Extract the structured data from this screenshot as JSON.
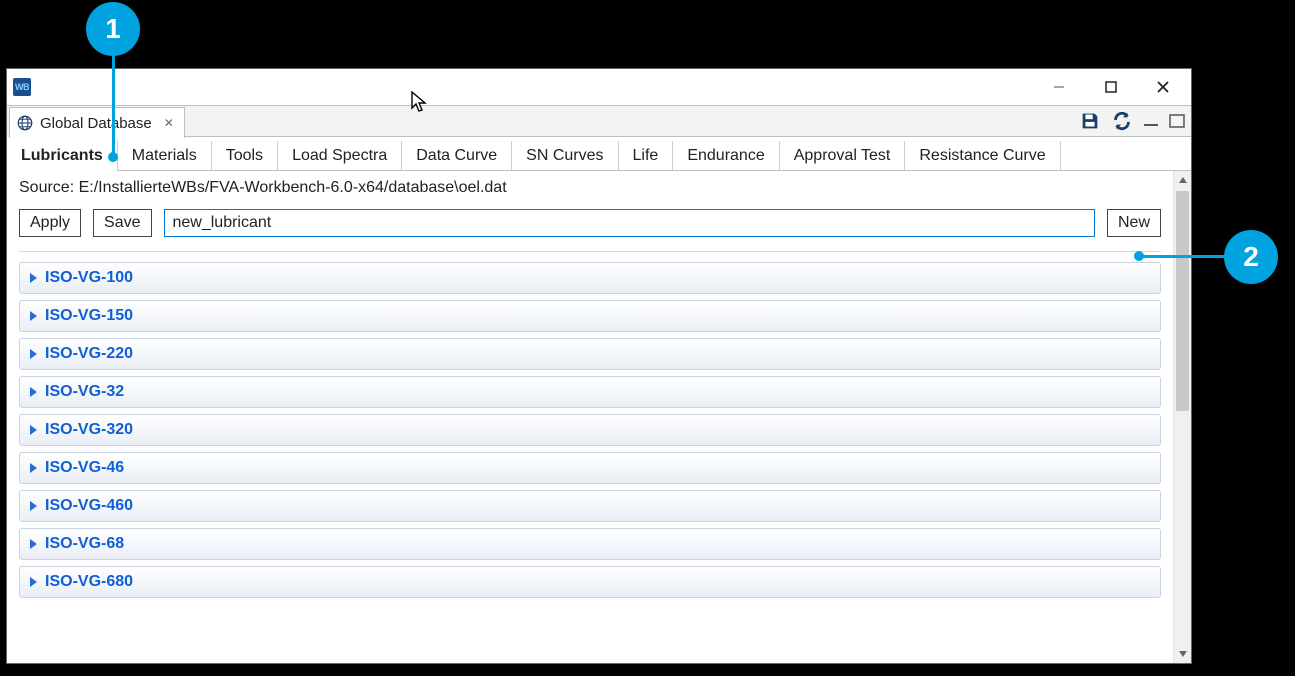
{
  "titlebar": {
    "app_icon_text": "WB"
  },
  "doc_tab": {
    "title": "Global Database",
    "close_glyph": "✕"
  },
  "tabs": [
    "Lubricants",
    "Materials",
    "Tools",
    "Load Spectra",
    "Data Curve",
    "SN Curves",
    "Life",
    "Endurance",
    "Approval Test",
    "Resistance Curve"
  ],
  "active_tab_index": 0,
  "source_label": "Source: E:/InstallierteWBs/FVA-Workbench-6.0-x64/database\\oel.dat",
  "buttons": {
    "apply": "Apply",
    "save": "Save",
    "new": "New"
  },
  "name_input_value": "new_lubricant",
  "list_items": [
    "ISO-VG-100",
    "ISO-VG-150",
    "ISO-VG-220",
    "ISO-VG-32",
    "ISO-VG-320",
    "ISO-VG-46",
    "ISO-VG-460",
    "ISO-VG-68",
    "ISO-VG-680"
  ],
  "callouts": {
    "one": "1",
    "two": "2"
  }
}
